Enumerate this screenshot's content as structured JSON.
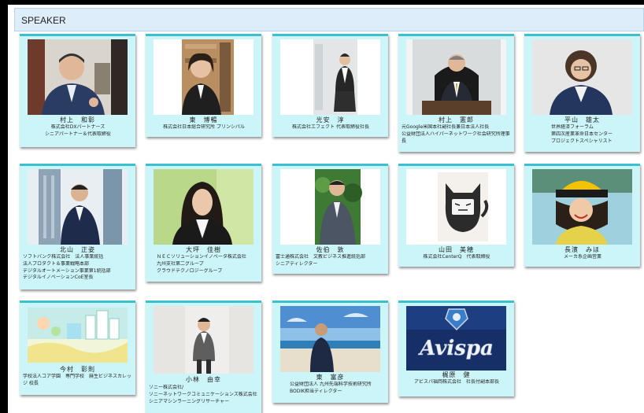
{
  "section": {
    "title": "SPEAKER"
  },
  "speakers": [
    {
      "name": "村上　和彰",
      "lines": [
        "株式会社DXパートナーズ",
        "シニアパートナー＆代表取締役"
      ]
    },
    {
      "name": "東　博暢",
      "lines": [
        "株式会社日本総合研究所 プリンシパル"
      ]
    },
    {
      "name": "光安　淳",
      "lines": [
        "株式会社エフェクト 代表取締役社長"
      ]
    },
    {
      "name": "村上　憲郎",
      "lines": [
        "元Google米国本社副社長兼日本法人社長",
        "公益財団法人ハイパーネットワーク社会研究所理事長"
      ]
    },
    {
      "name": "平山　雄太",
      "lines": [
        "世界経済フォーラム",
        "第四次産業革命日本センター",
        "プロジェクトスペシャリスト"
      ]
    },
    {
      "name": "北山　正姿",
      "lines": [
        "ソフトバンク株式会社　法人事業統括",
        "法人プロダクト＆事業戦略本部",
        "デジタルオートメーション事業第1統括部",
        "デジタルイノベーションCoE室長"
      ]
    },
    {
      "name": "大坪　佳樹",
      "lines": [
        "ＮＥＣソリューションイノベータ株式会社",
        "九州支社第二グループ",
        "クラウドテクノロジーグループ"
      ]
    },
    {
      "name": "佐伯　敦",
      "lines": [
        "富士通株式会社　文教ビジネス推進統括部",
        "シニアディレクター"
      ]
    },
    {
      "name": "山田　美穂",
      "lines": [
        "株式会社CenterQ　代表取締役"
      ]
    },
    {
      "name": "長濱　みほ",
      "lines": [
        "メーカ系企画営業"
      ]
    },
    {
      "name": "今村　彰則",
      "lines": [
        "学校法人コア学園　専門学校　麻生ビジネスカレッジ 校長"
      ]
    },
    {
      "name": "小林　由幸",
      "lines": [
        "ソニー株式会社/",
        "ソニーネットワークコミュニケーションズ株式会社",
        "シニアマシンラーニングリサーチャー"
      ]
    },
    {
      "name": "東　富彦",
      "lines": [
        "公益財団法人 九州先端科学技術研究所",
        "BODIK担当ディレクター"
      ]
    },
    {
      "name": "梶原　健",
      "lines": [
        "アビスパ福岡株式会社　社長付副本部長"
      ]
    }
  ],
  "logo": {
    "text": "Avispa"
  },
  "colors": {
    "card": "#ccf5f9",
    "accent": "#3cc0cf",
    "header": "#ddeefa"
  }
}
